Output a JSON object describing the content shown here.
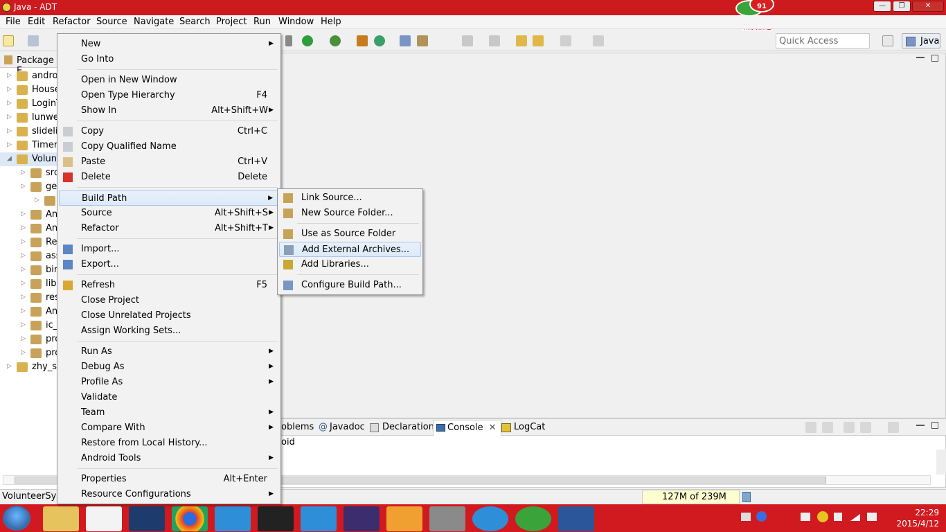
{
  "window": {
    "title": "Java - ADT"
  },
  "menubar": {
    "items": [
      "File",
      "Edit",
      "Refactor",
      "Source",
      "Navigate",
      "Search",
      "Project",
      "Run",
      "Window",
      "Help"
    ]
  },
  "mascot": {
    "count": "91",
    "label": "点我加速"
  },
  "toolbar": {
    "quick_access_placeholder": "Quick Access",
    "perspective": "Java"
  },
  "package_explorer": {
    "title": "Package E",
    "items": [
      {
        "label": "andro",
        "level": 0
      },
      {
        "label": "House",
        "level": 0
      },
      {
        "label": "LoginT",
        "level": 0
      },
      {
        "label": "lunwer",
        "level": 0
      },
      {
        "label": "slideli",
        "level": 0
      },
      {
        "label": "Timer",
        "level": 0
      },
      {
        "label": "Volunt",
        "level": 0,
        "selected": true
      },
      {
        "label": "src",
        "level": 1
      },
      {
        "label": "ge",
        "level": 1
      },
      {
        "label": "",
        "level": 2
      },
      {
        "label": "An",
        "level": 1
      },
      {
        "label": "An",
        "level": 1
      },
      {
        "label": "Re",
        "level": 1
      },
      {
        "label": "ass",
        "level": 1
      },
      {
        "label": "bir",
        "level": 1
      },
      {
        "label": "libs",
        "level": 1
      },
      {
        "label": "res",
        "level": 1
      },
      {
        "label": "An",
        "level": 1
      },
      {
        "label": "ic_l",
        "level": 1
      },
      {
        "label": "pro",
        "level": 1
      },
      {
        "label": "pro",
        "level": 1
      },
      {
        "label": "zhy_sli",
        "level": 0
      }
    ]
  },
  "context_menu": {
    "items": [
      {
        "label": "New",
        "accel": "",
        "sub": true
      },
      {
        "label": "Go Into",
        "accel": "",
        "sub": false
      },
      {
        "label": "Open in New Window",
        "accel": "",
        "sub": false
      },
      {
        "label": "Open Type Hierarchy",
        "accel": "F4",
        "sub": false
      },
      {
        "label": "Show In",
        "accel": "Alt+Shift+W",
        "sub": true
      },
      {
        "label": "Copy",
        "accel": "Ctrl+C",
        "sub": false
      },
      {
        "label": "Copy Qualified Name",
        "accel": "",
        "sub": false
      },
      {
        "label": "Paste",
        "accel": "Ctrl+V",
        "sub": false
      },
      {
        "label": "Delete",
        "accel": "Delete",
        "sub": false
      },
      {
        "label": "Build Path",
        "accel": "",
        "sub": true
      },
      {
        "label": "Source",
        "accel": "Alt+Shift+S",
        "sub": true
      },
      {
        "label": "Refactor",
        "accel": "Alt+Shift+T",
        "sub": true
      },
      {
        "label": "Import...",
        "accel": "",
        "sub": false
      },
      {
        "label": "Export...",
        "accel": "",
        "sub": false
      },
      {
        "label": "Refresh",
        "accel": "F5",
        "sub": false
      },
      {
        "label": "Close Project",
        "accel": "",
        "sub": false
      },
      {
        "label": "Close Unrelated Projects",
        "accel": "",
        "sub": false
      },
      {
        "label": "Assign Working Sets...",
        "accel": "",
        "sub": false
      },
      {
        "label": "Run As",
        "accel": "",
        "sub": true
      },
      {
        "label": "Debug As",
        "accel": "",
        "sub": true
      },
      {
        "label": "Profile As",
        "accel": "",
        "sub": true
      },
      {
        "label": "Validate",
        "accel": "",
        "sub": false
      },
      {
        "label": "Team",
        "accel": "",
        "sub": true
      },
      {
        "label": "Compare With",
        "accel": "",
        "sub": true
      },
      {
        "label": "Restore from Local History...",
        "accel": "",
        "sub": false
      },
      {
        "label": "Android Tools",
        "accel": "",
        "sub": true
      },
      {
        "label": "Properties",
        "accel": "Alt+Enter",
        "sub": false
      },
      {
        "label": "Resource Configurations",
        "accel": "",
        "sub": true
      }
    ]
  },
  "build_path_submenu": {
    "items": [
      "Link Source...",
      "New Source Folder...",
      "Use as Source Folder",
      "Add External Archives...",
      "Add Libraries...",
      "Configure Build Path..."
    ]
  },
  "bottom_panel": {
    "tabs": [
      "oblems",
      "Javadoc",
      "Declaration",
      "Console",
      "LogCat"
    ],
    "console_text": "oid"
  },
  "status": {
    "project": "VolunteerSyst",
    "heap": "127M of 239M"
  },
  "taskbar": {
    "time": "22:29",
    "date": "2015/4/12"
  }
}
